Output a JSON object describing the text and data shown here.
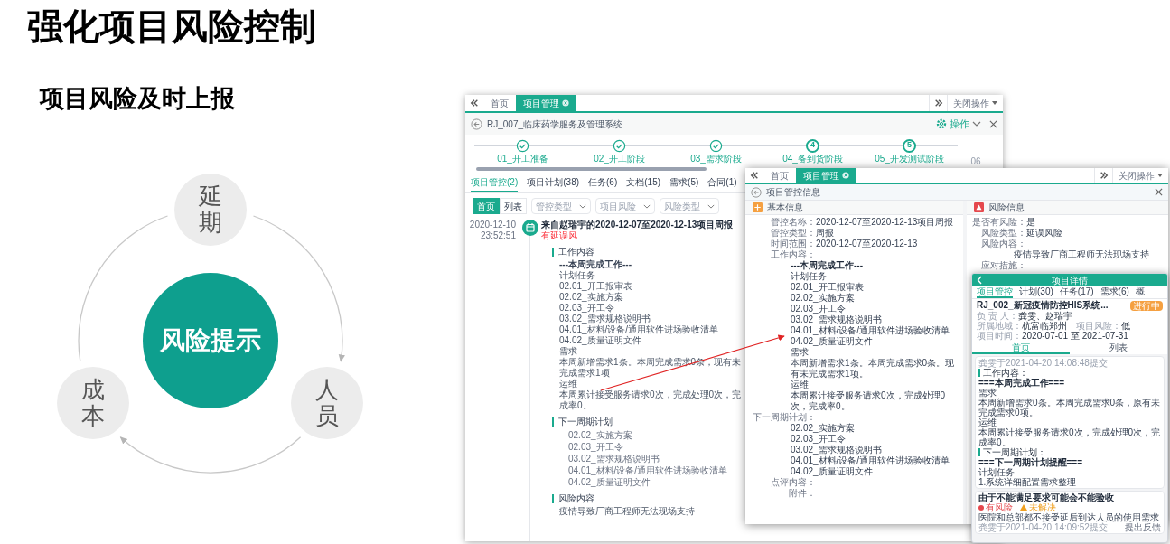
{
  "slide": {
    "title": "强化项目风险控制",
    "subtitle": "项目风险及时上报"
  },
  "cycle": {
    "center": "风险提示",
    "nodes": [
      {
        "label": "延期"
      },
      {
        "label": "人员"
      },
      {
        "label": "成本"
      }
    ]
  },
  "back_window": {
    "tabs": [
      {
        "label": "首页",
        "selected": false
      },
      {
        "label": "项目管理",
        "selected": true
      }
    ],
    "close_menu": "关闭操作",
    "project_title": "RJ_007_临床药学服务及管理系统",
    "operation_menu": "操作",
    "steps": [
      {
        "label": "01_开工准备",
        "done": true
      },
      {
        "label": "02_开工阶段",
        "done": true
      },
      {
        "label": "03_需求阶段",
        "done": true
      },
      {
        "number": "4",
        "label": "04_备到货阶段",
        "done": false
      },
      {
        "number": "5",
        "label": "05_开发测试阶段",
        "done": false
      }
    ],
    "next_step": "06",
    "sub_tabs": [
      {
        "label": "项目管控(2)",
        "selected": true
      },
      {
        "label": "项目计划(38)",
        "selected": false
      },
      {
        "label": "任务(6)",
        "selected": false
      },
      {
        "label": "文档(15)",
        "selected": false
      },
      {
        "label": "需求(5)",
        "selected": false
      },
      {
        "label": "合同(1)",
        "selected": false
      }
    ],
    "view_toggle": [
      {
        "label": "首页",
        "selected": true
      },
      {
        "label": "列表",
        "selected": false
      }
    ],
    "filters": [
      {
        "placeholder": "管控类型"
      },
      {
        "placeholder": "项目风险"
      },
      {
        "placeholder": "风险类型"
      }
    ],
    "entry": {
      "date": "2020-12-10",
      "time": "23:52:51",
      "title": "来自赵瑞宇的2020-12-07至2020-12-13项目周报",
      "flag": "有延误风",
      "sections": [
        {
          "heading": "工作内容",
          "lines": [
            {
              "kind": "banner",
              "text": "---本周完成工作---"
            },
            {
              "kind": "text",
              "text": "计划任务"
            },
            {
              "kind": "text",
              "text": "02.01_开工报审表"
            },
            {
              "kind": "text",
              "text": "02.02_实施方案"
            },
            {
              "kind": "text",
              "text": "02.03_开工令"
            },
            {
              "kind": "text",
              "text": "03.02_需求规格说明书"
            },
            {
              "kind": "text",
              "text": "04.01_材料/设备/通用软件进场验收清单"
            },
            {
              "kind": "text",
              "text": "04.02_质量证明文件"
            },
            {
              "kind": "text",
              "text": "需求"
            },
            {
              "kind": "text",
              "text": "本周新增需求1条。本周完成需求0条，现有未完成需求1项"
            },
            {
              "kind": "text",
              "text": "运维"
            },
            {
              "kind": "text",
              "text": "本周累计接受服务请求0次，完成处理0次，完成率0。"
            }
          ]
        },
        {
          "heading": "下一周期计划",
          "lines": [
            {
              "kind": "item",
              "text": "02.02_实施方案"
            },
            {
              "kind": "item",
              "text": "02.03_开工令"
            },
            {
              "kind": "item",
              "text": "03.02_需求规格说明书"
            },
            {
              "kind": "item",
              "text": "04.01_材料/设备/通用软件进场验收清单"
            },
            {
              "kind": "item",
              "text": "04.02_质量证明文件"
            }
          ]
        },
        {
          "heading": "风险内容",
          "lines": [
            {
              "kind": "text",
              "text": "疫情导致厂商工程师无法现场支持"
            }
          ]
        }
      ]
    }
  },
  "front_window": {
    "tabs": [
      {
        "label": "首页",
        "selected": false
      },
      {
        "label": "项目管理",
        "selected": true
      }
    ],
    "close_menu": "关闭操作",
    "title": "项目管控信息",
    "basic_info": {
      "heading": "基本信息",
      "fields": [
        {
          "label": "管控名称：",
          "value": "2020-12-07至2020-12-13项目周报"
        },
        {
          "label": "管控类型：",
          "value": "周报"
        },
        {
          "label": "时间范围：",
          "value": "2020-12-07至2020-12-13"
        },
        {
          "label": "工作内容：",
          "lines": [
            {
              "kind": "banner",
              "text": "---本周完成工作---"
            },
            {
              "kind": "text",
              "text": "计划任务"
            },
            {
              "kind": "text",
              "text": "02.01_开工报审表"
            },
            {
              "kind": "text",
              "text": "02.02_实施方案"
            },
            {
              "kind": "text",
              "text": "02.03_开工令"
            },
            {
              "kind": "text",
              "text": "03.02_需求规格说明书"
            },
            {
              "kind": "text",
              "text": "04.01_材料/设备/通用软件进场验收清单"
            },
            {
              "kind": "text",
              "text": "04.02_质量证明文件"
            },
            {
              "kind": "text",
              "text": "需求"
            },
            {
              "kind": "text",
              "text": "本周新增需求1条。本周完成需求0条。现有未完成需求1项。"
            },
            {
              "kind": "text",
              "text": "运维"
            },
            {
              "kind": "text",
              "text": "本周累计接受服务请求0次，完成处理0次，完成率0。"
            }
          ]
        },
        {
          "label": "下一周期计划：",
          "lines": [
            {
              "kind": "text",
              "text": "02.02_实施方案"
            },
            {
              "kind": "text",
              "text": "02.03_开工令"
            },
            {
              "kind": "text",
              "text": "03.02_需求规格说明书"
            },
            {
              "kind": "text",
              "text": "04.01_材料/设备/通用软件进场验收清单"
            },
            {
              "kind": "text",
              "text": "04.02_质量证明文件"
            }
          ]
        },
        {
          "label": "点评内容："
        },
        {
          "label": "附件："
        }
      ]
    },
    "risk_info": {
      "heading": "风险信息",
      "fields": [
        {
          "label": "是否有风险：",
          "value": "是"
        },
        {
          "label": "风险类型：",
          "value": "延误风险"
        },
        {
          "label": "风险内容：",
          "lines": [
            {
              "text": "疫情导致厂商工程师无法现场支持"
            }
          ]
        },
        {
          "label": "应对措施："
        }
      ]
    }
  },
  "phone": {
    "title": "项目详情",
    "tabs": [
      {
        "label": "项目管控",
        "selected": true
      },
      {
        "label": "计划(30)",
        "selected": false
      },
      {
        "label": "任务(17)",
        "selected": false
      },
      {
        "label": "需求(6)",
        "selected": false
      },
      {
        "label": "概",
        "selected": false
      }
    ],
    "project": "RJ_002_新冠疫情防控HIS系统...",
    "status": "进行中",
    "info_rows": [
      {
        "items": [
          {
            "label": "负 责 人：",
            "value": "龚雯、赵瑞宇"
          }
        ]
      },
      {
        "items": [
          {
            "label": "所属地域：",
            "value": "杭富临郑州"
          },
          {
            "label": "项目风险：",
            "value": "低"
          }
        ]
      },
      {
        "items": [
          {
            "label": "项目时间：",
            "value": "2020-07-01 至 2021-07-31"
          }
        ]
      }
    ],
    "view_toggle": [
      {
        "label": "首页",
        "selected": true
      },
      {
        "label": "列表",
        "selected": false
      }
    ],
    "report": {
      "submitted": "龚雯于2021-04-20 14:08:48提交",
      "sections": [
        {
          "heading": "工作内容：",
          "lines": [
            {
              "kind": "banner",
              "text": "===本周完成工作==="
            },
            {
              "kind": "text",
              "text": "需求"
            },
            {
              "kind": "text",
              "text": "本周新增需求0条。本周完成需求0条，原有未完成需求0项。"
            },
            {
              "kind": "text",
              "text": "运维"
            },
            {
              "kind": "text",
              "text": "本周累计接受服务请求0次，完成处理0次，完成率0。"
            }
          ]
        },
        {
          "heading": "下一周期计划：",
          "lines": [
            {
              "kind": "banner",
              "text": "===下一周期计划提醒==="
            },
            {
              "kind": "text",
              "text": "计划任务"
            },
            {
              "kind": "text",
              "text": "1.系统详细配置需求整理"
            }
          ]
        }
      ]
    },
    "risk_card": {
      "title": "由于不能满足要求可能会不能验收",
      "tags": [
        {
          "label": "有风险",
          "kind": "dot",
          "color": "#e5484d"
        },
        {
          "label": "未解决",
          "kind": "warning",
          "color": "#f0a020"
        }
      ],
      "text": "医院和总部都不接受延后到达人员的使用需求",
      "submitted": "龚雯于2021-04-20 14:09:52提交",
      "action": "提出反馈"
    }
  }
}
